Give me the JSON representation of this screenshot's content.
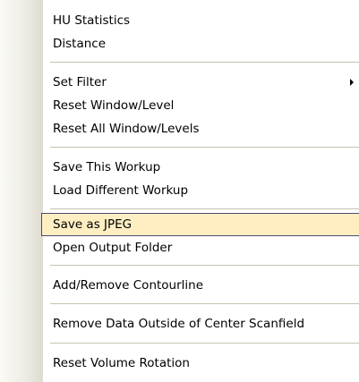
{
  "menu": {
    "items": [
      {
        "label": "HU Statistics"
      },
      {
        "label": "Distance"
      },
      {
        "label": "Set Filter",
        "has_submenu": true
      },
      {
        "label": "Reset Window/Level"
      },
      {
        "label": "Reset All Window/Levels"
      },
      {
        "label": "Save This Workup"
      },
      {
        "label": "Load Different Workup"
      },
      {
        "label": "Save as JPEG",
        "highlighted": true
      },
      {
        "label": "Open Output Folder"
      },
      {
        "label": "Add/Remove Contourline"
      },
      {
        "label": "Remove Data Outside of Center Scanfield"
      },
      {
        "label": "Reset Volume Rotation"
      }
    ]
  },
  "colors": {
    "highlight_fill": "#ffeec2",
    "highlight_border": "#4b4b6f",
    "separator": "#c5c2b2",
    "gutter": "#eeede5"
  }
}
